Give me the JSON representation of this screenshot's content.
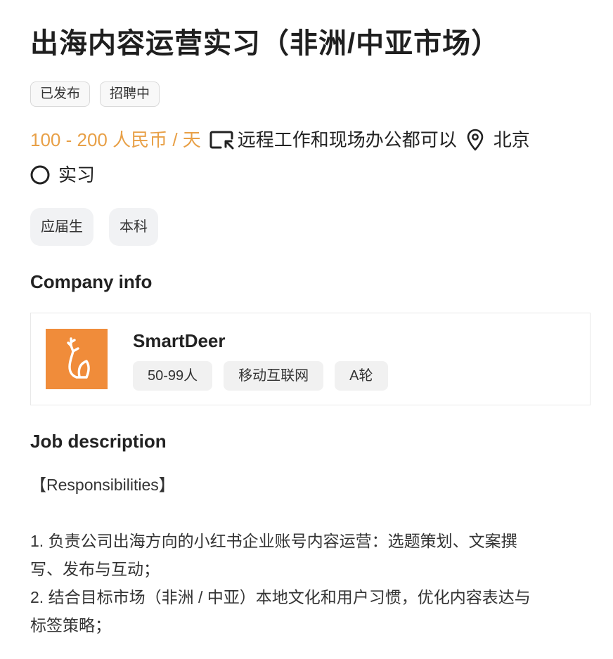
{
  "job": {
    "title": "出海内容运营实习（非洲/中亚市场）",
    "status_tags": [
      "已发布",
      "招聘中"
    ],
    "salary": "100 - 200 人民币 / 天",
    "work_mode": "远程工作和现场办公都可以",
    "location": "北京",
    "job_type": "实习",
    "requirement_tags": [
      "应届生",
      "本科"
    ]
  },
  "company_section": {
    "heading": "Company info",
    "name": "SmartDeer",
    "tags": [
      "50-99人",
      "移动互联网",
      "A轮"
    ],
    "logo_color": "#f08c3a"
  },
  "job_section": {
    "heading": "Job description",
    "lines": [
      "【Responsibilities】",
      "",
      "1. 负责公司出海方向的小红书企业账号内容运营：选题策划、文案撰",
      "写、发布与互动；",
      "2. 结合目标市场（非洲 / 中亚）本地文化和用户习惯，优化内容表达与",
      "标签策略；"
    ]
  },
  "colors": {
    "salary": "#e8a047",
    "tag_bg": "#f1f2f4"
  },
  "icons": {
    "work_mode": "remote-office-icon",
    "location": "location-pin-icon",
    "job_type": "circle-icon"
  }
}
